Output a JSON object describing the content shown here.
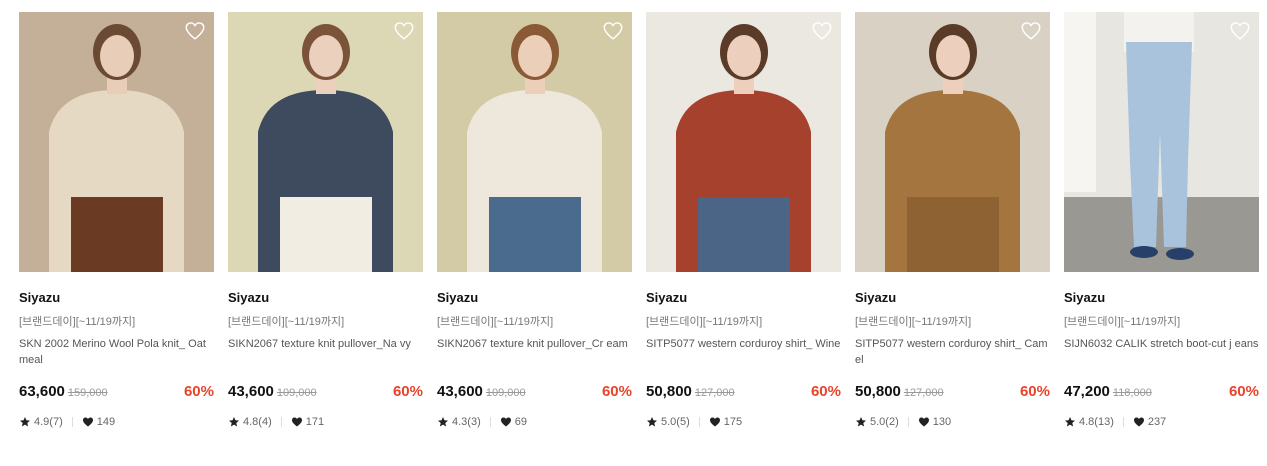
{
  "products": [
    {
      "brand": "Siyazu",
      "tag": "[브랜드데이][~11/19까지]",
      "name": "SKN 2002 Merino Wool Pola knit_ Oatmeal",
      "price": "63,600",
      "original_price": "159,000",
      "discount": "60%",
      "rating": "4.9(7)",
      "likes": "149",
      "photo": {
        "bg": "#c4b098",
        "top": "#e6d9c4",
        "bottom": "#6a3a22",
        "hair": "#6b4a33",
        "skin": "#e8cdb8"
      }
    },
    {
      "brand": "Siyazu",
      "tag": "[브랜드데이][~11/19까지]",
      "name": "SIKN2067 texture knit pullover_Na vy",
      "price": "43,600",
      "original_price": "109,000",
      "discount": "60%",
      "rating": "4.8(4)",
      "likes": "171",
      "photo": {
        "bg": "#dcd7b4",
        "top": "#3e4a5e",
        "bottom": "#f1ede2",
        "hair": "#7a5338",
        "skin": "#ead0bd"
      }
    },
    {
      "brand": "Siyazu",
      "tag": "[브랜드데이][~11/19까지]",
      "name": "SIKN2067 texture knit pullover_Cr eam",
      "price": "43,600",
      "original_price": "109,000",
      "discount": "60%",
      "rating": "4.3(3)",
      "likes": "69",
      "photo": {
        "bg": "#d3caa6",
        "top": "#eee8dc",
        "bottom": "#4a6a8e",
        "hair": "#8a5a36",
        "skin": "#ebcfb8"
      }
    },
    {
      "brand": "Siyazu",
      "tag": "[브랜드데이][~11/19까지]",
      "name": "SITP5077 western corduroy shirt_ Wine",
      "price": "50,800",
      "original_price": "127,000",
      "discount": "60%",
      "rating": "5.0(5)",
      "likes": "175",
      "photo": {
        "bg": "#ebe7e1",
        "top": "#a5412c",
        "bottom": "#4a6586",
        "hair": "#5a3b28",
        "skin": "#ecd0bd"
      }
    },
    {
      "brand": "Siyazu",
      "tag": "[브랜드데이][~11/19까지]",
      "name": "SITP5077 western corduroy shirt_ Camel",
      "price": "50,800",
      "original_price": "127,000",
      "discount": "60%",
      "rating": "5.0(2)",
      "likes": "130",
      "photo": {
        "bg": "#d9d2c4",
        "top": "#a5753f",
        "bottom": "#8e6232",
        "hair": "#5a3b28",
        "skin": "#ecd0bd"
      }
    },
    {
      "brand": "Siyazu",
      "tag": "[브랜드데이][~11/19까지]",
      "name": "SIJN6032 CALIK stretch boot-cut j eans",
      "price": "47,200",
      "original_price": "118,000",
      "discount": "60%",
      "rating": "4.8(13)",
      "likes": "237",
      "photo": {
        "bg": "#e8e6e0",
        "top": "#f4f2ee",
        "bottom": "#a9c3dc",
        "hair": "#e8e6e0",
        "skin": "#e8e6e0"
      }
    }
  ],
  "icons": {
    "wishlist": "heart-outline-icon",
    "rating": "star-icon",
    "likes": "heart-filled-icon"
  },
  "colors": {
    "discount": "#e8442a",
    "brand_text": "#111111",
    "muted_text": "#777777"
  }
}
